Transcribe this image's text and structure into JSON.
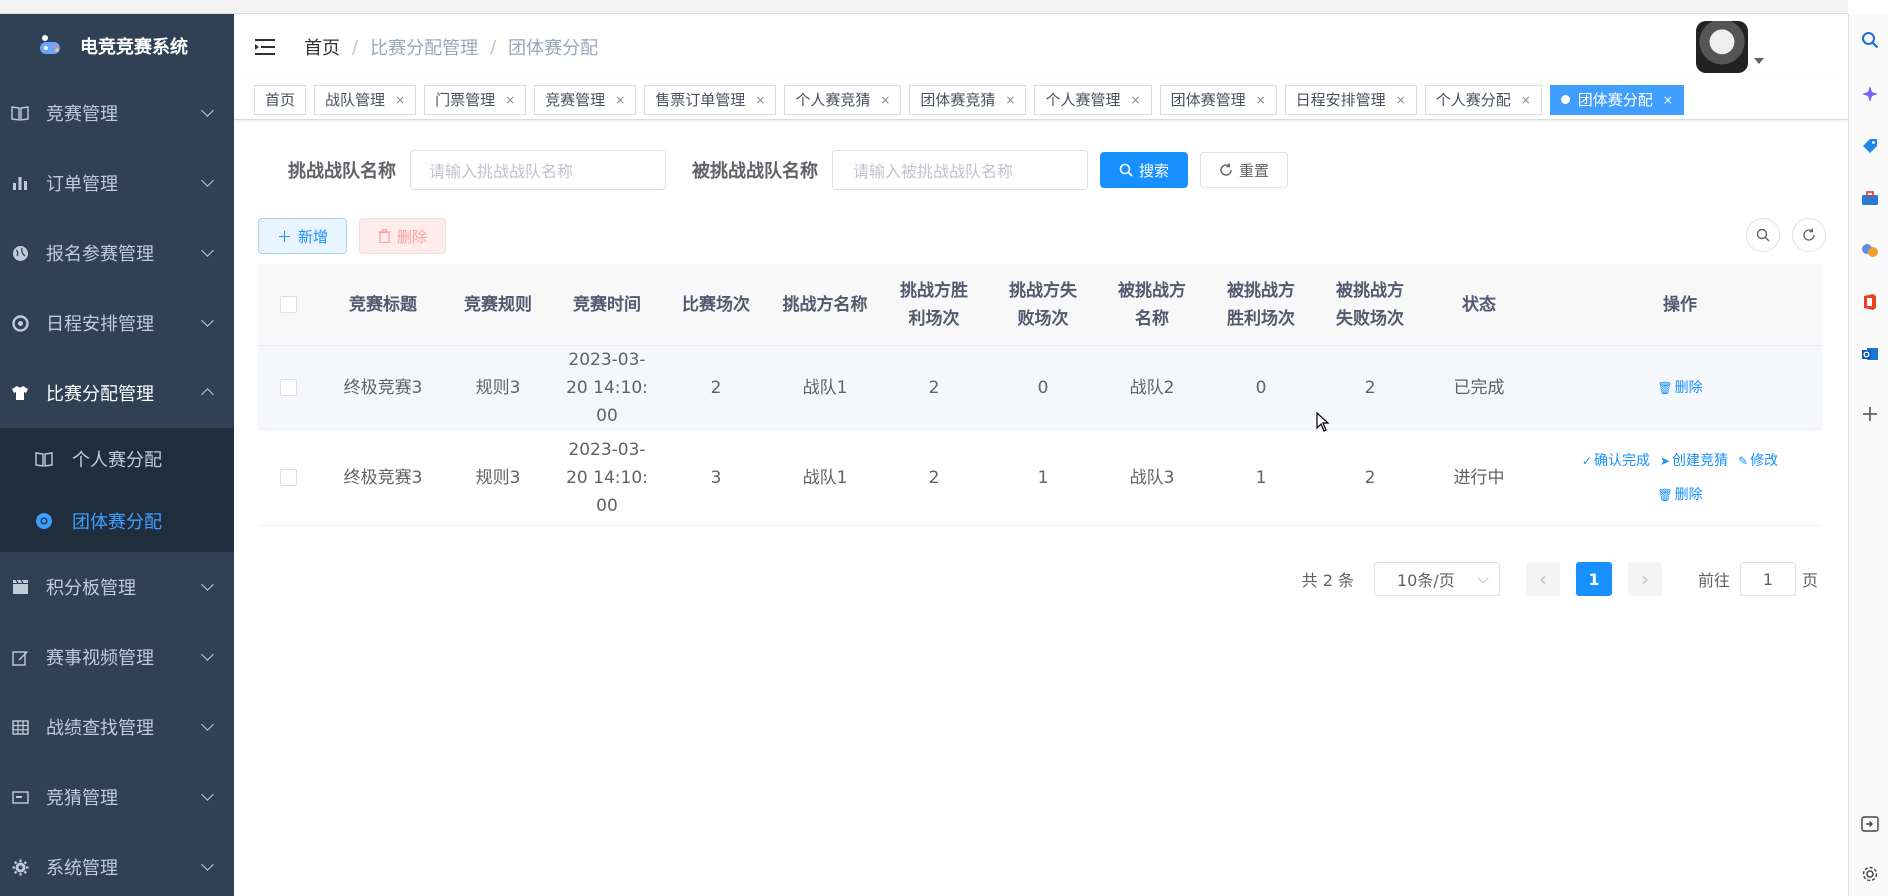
{
  "app": {
    "title": "电竞竞赛系统"
  },
  "colors": {
    "sidebar_bg": "#304156",
    "accent": "#1890ff",
    "submenu_bg": "#1f2d3d"
  },
  "sidebar": {
    "items": [
      {
        "label": "竞赛管理",
        "icon": "book-icon"
      },
      {
        "label": "订单管理",
        "icon": "bar-chart-icon"
      },
      {
        "label": "报名参赛管理",
        "icon": "globe-icon"
      },
      {
        "label": "日程安排管理",
        "icon": "target-icon"
      },
      {
        "label": "比赛分配管理",
        "icon": "shirt-icon",
        "open": true,
        "children": [
          {
            "label": "个人赛分配",
            "icon": "book-icon"
          },
          {
            "label": "团体赛分配",
            "icon": "chrome-icon",
            "active": true
          }
        ]
      },
      {
        "label": "积分板管理",
        "icon": "clapper-icon"
      },
      {
        "label": "赛事视频管理",
        "icon": "edit-icon"
      },
      {
        "label": "战绩查找管理",
        "icon": "table-icon"
      },
      {
        "label": "竞猜管理",
        "icon": "monitor-icon"
      },
      {
        "label": "系统管理",
        "icon": "gear-icon"
      }
    ]
  },
  "breadcrumb": [
    "首页",
    "比赛分配管理",
    "团体赛分配"
  ],
  "tags": [
    {
      "label": "首页",
      "closable": false
    },
    {
      "label": "战队管理",
      "closable": true
    },
    {
      "label": "门票管理",
      "closable": true
    },
    {
      "label": "竞赛管理",
      "closable": true
    },
    {
      "label": "售票订单管理",
      "closable": true
    },
    {
      "label": "个人赛竞猜",
      "closable": true
    },
    {
      "label": "团体赛竞猜",
      "closable": true
    },
    {
      "label": "个人赛管理",
      "closable": true
    },
    {
      "label": "团体赛管理",
      "closable": true
    },
    {
      "label": "日程安排管理",
      "closable": true
    },
    {
      "label": "个人赛分配",
      "closable": true
    },
    {
      "label": "团体赛分配",
      "closable": true,
      "active": true
    }
  ],
  "search": {
    "challenger_label": "挑战战队名称",
    "challenger_placeholder": "请输入挑战战队名称",
    "challenged_label": "被挑战战队名称",
    "challenged_placeholder": "请输入被挑战战队名称",
    "search_button": "搜索",
    "reset_button": "重置"
  },
  "toolbar": {
    "add_button": "新增",
    "delete_button": "删除"
  },
  "table": {
    "columns": [
      "竞赛标题",
      "竞赛规则",
      "竞赛时间",
      "比赛场次",
      "挑战方名称",
      "挑战方胜利场次",
      "挑战方失败场次",
      "被挑战方名称",
      "被挑战方胜利场次",
      "被挑战方失败场次",
      "状态",
      "操作"
    ],
    "rows": [
      {
        "cells": [
          "终极竞赛3",
          "规则3",
          "2023-03-20 14:10:00",
          "2",
          "战队1",
          "2",
          "0",
          "战队2",
          "0",
          "2",
          "已完成"
        ],
        "actions": [
          "删除"
        ]
      },
      {
        "cells": [
          "终极竞赛3",
          "规则3",
          "2023-03-20 14:10:00",
          "3",
          "战队1",
          "2",
          "1",
          "战队3",
          "1",
          "2",
          "进行中"
        ],
        "actions": [
          "确认完成",
          "创建竞猜",
          "修改",
          "删除"
        ]
      }
    ]
  },
  "pagination": {
    "total": "共 2 条",
    "page_size": "10条/页",
    "current": "1",
    "goto_label": "前往",
    "goto_value": "1",
    "page_unit": "页"
  }
}
